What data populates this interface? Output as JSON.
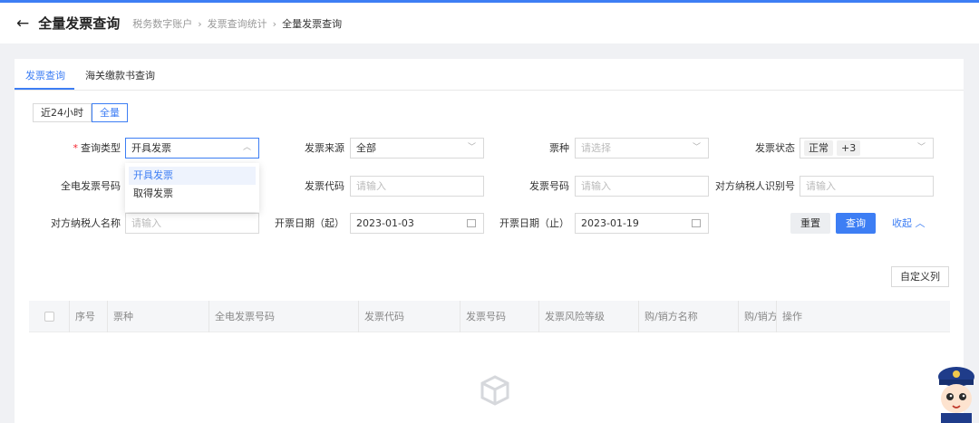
{
  "header": {
    "back_icon": "←",
    "title": "全量发票查询",
    "breadcrumb": [
      "税务数字账户",
      "发票查询统计",
      "全量发票查询"
    ]
  },
  "tabs": [
    {
      "label": "发票查询",
      "active": true
    },
    {
      "label": "海关缴款书查询",
      "active": false
    }
  ],
  "time_range": {
    "options": [
      "近24小时",
      "全量"
    ],
    "selected": "全量"
  },
  "form": {
    "query_type": {
      "label": "查询类型",
      "value": "开具发票",
      "required": true
    },
    "invoice_source": {
      "label": "发票来源",
      "value": "全部"
    },
    "invoice_kind": {
      "label": "票种",
      "placeholder": "请选择"
    },
    "invoice_status": {
      "label": "发票状态",
      "tags": [
        "正常",
        "+3"
      ]
    },
    "eletronic_no": {
      "label": "全电发票号码"
    },
    "invoice_code": {
      "label": "发票代码",
      "placeholder": "请输入"
    },
    "invoice_number": {
      "label": "发票号码",
      "placeholder": "请输入"
    },
    "counterparty_id": {
      "label": "对方纳税人识别号",
      "placeholder": "请输入"
    },
    "counterparty_name": {
      "label": "对方纳税人名称",
      "placeholder": "请输入"
    },
    "date_start": {
      "label": "开票日期（起）",
      "value": "2023-01-03"
    },
    "date_end": {
      "label": "开票日期（止）",
      "value": "2023-01-19"
    }
  },
  "dropdown": {
    "options": [
      "开具发票",
      "取得发票"
    ],
    "selected": "开具发票"
  },
  "actions": {
    "reset": "重置",
    "query": "查询",
    "collapse": "收起",
    "custom_columns": "自定义列"
  },
  "table": {
    "columns": [
      "序号",
      "票种",
      "全电发票号码",
      "发票代码",
      "发票号码",
      "发票风险等级",
      "购/销方名称",
      "购/销方",
      "操作"
    ]
  },
  "colors": {
    "accent": "#3d7ef4"
  }
}
